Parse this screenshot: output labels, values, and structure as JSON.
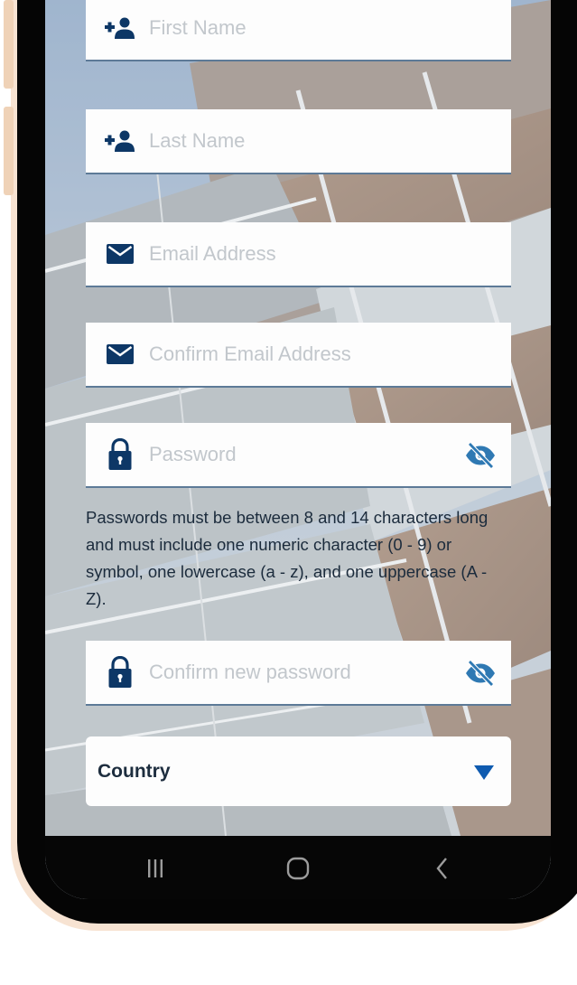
{
  "form": {
    "first_name_placeholder": "First Name",
    "last_name_placeholder": "Last Name",
    "email_placeholder": "Email Address",
    "confirm_email_placeholder": "Confirm Email Address",
    "password_placeholder": "Password",
    "password_hint": "Passwords must be between 8 and 14 characters long and must include one numeric character (0 - 9) or symbol, one lowercase (a - z), and one uppercase (A - Z).",
    "confirm_password_placeholder": "Confirm new password",
    "country_label": "Country"
  },
  "icons": {
    "add_person": "add-person-icon",
    "envelope": "envelope-icon",
    "lock": "lock-icon",
    "eye_off": "eye-off-icon",
    "dropdown": "caret-down-icon"
  },
  "colors": {
    "icon_primary": "#0d3766",
    "eye_icon": "#2f79b3",
    "dropdown_arrow": "#0f5bb0",
    "field_border": "#5d7a97",
    "placeholder": "#c2c7cc",
    "hint_text": "#1b2b3c",
    "frame_outer": "#f7e3d2"
  }
}
